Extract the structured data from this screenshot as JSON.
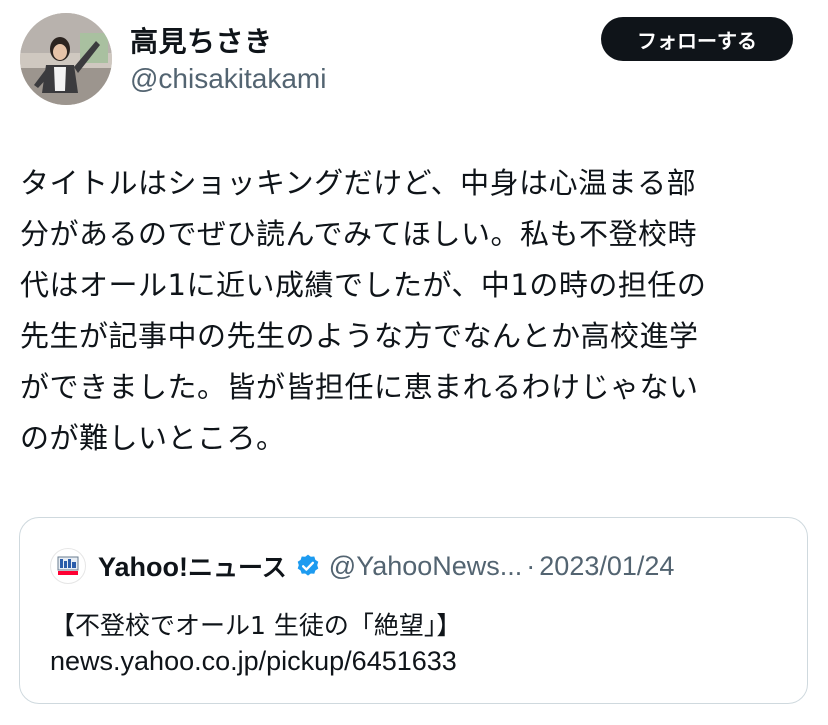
{
  "author": {
    "display_name": "高見ちさき",
    "handle": "@chisakitakami",
    "avatar_icon": "profile-photo"
  },
  "follow_button": {
    "label": "フォローする"
  },
  "tweet": {
    "lines": [
      "タイトルはショッキングだけど、中身は心温まる部",
      "分があるのでぜひ読んでみてほしい。私も不登校時",
      "代はオール1に近い成績でしたが、中1の時の担任の",
      "先生が記事中の先生のような方でなんとか高校進学",
      "ができました。皆が皆担任に恵まれるわけじゃない",
      "のが難しいところ。"
    ]
  },
  "quote": {
    "name_prefix": "Yahoo!",
    "name_suffix": "ニュース",
    "handle": "@YahooNews...",
    "separator": "·",
    "date": "2023/01/24",
    "title": "【不登校でオール1 生徒の「絶望」】",
    "url": "news.yahoo.co.jp/pickup/6451633",
    "logo_icon": "yahoo-news-logo",
    "verified_icon": "verified-badge",
    "verified_color": "#1d9bf0"
  }
}
